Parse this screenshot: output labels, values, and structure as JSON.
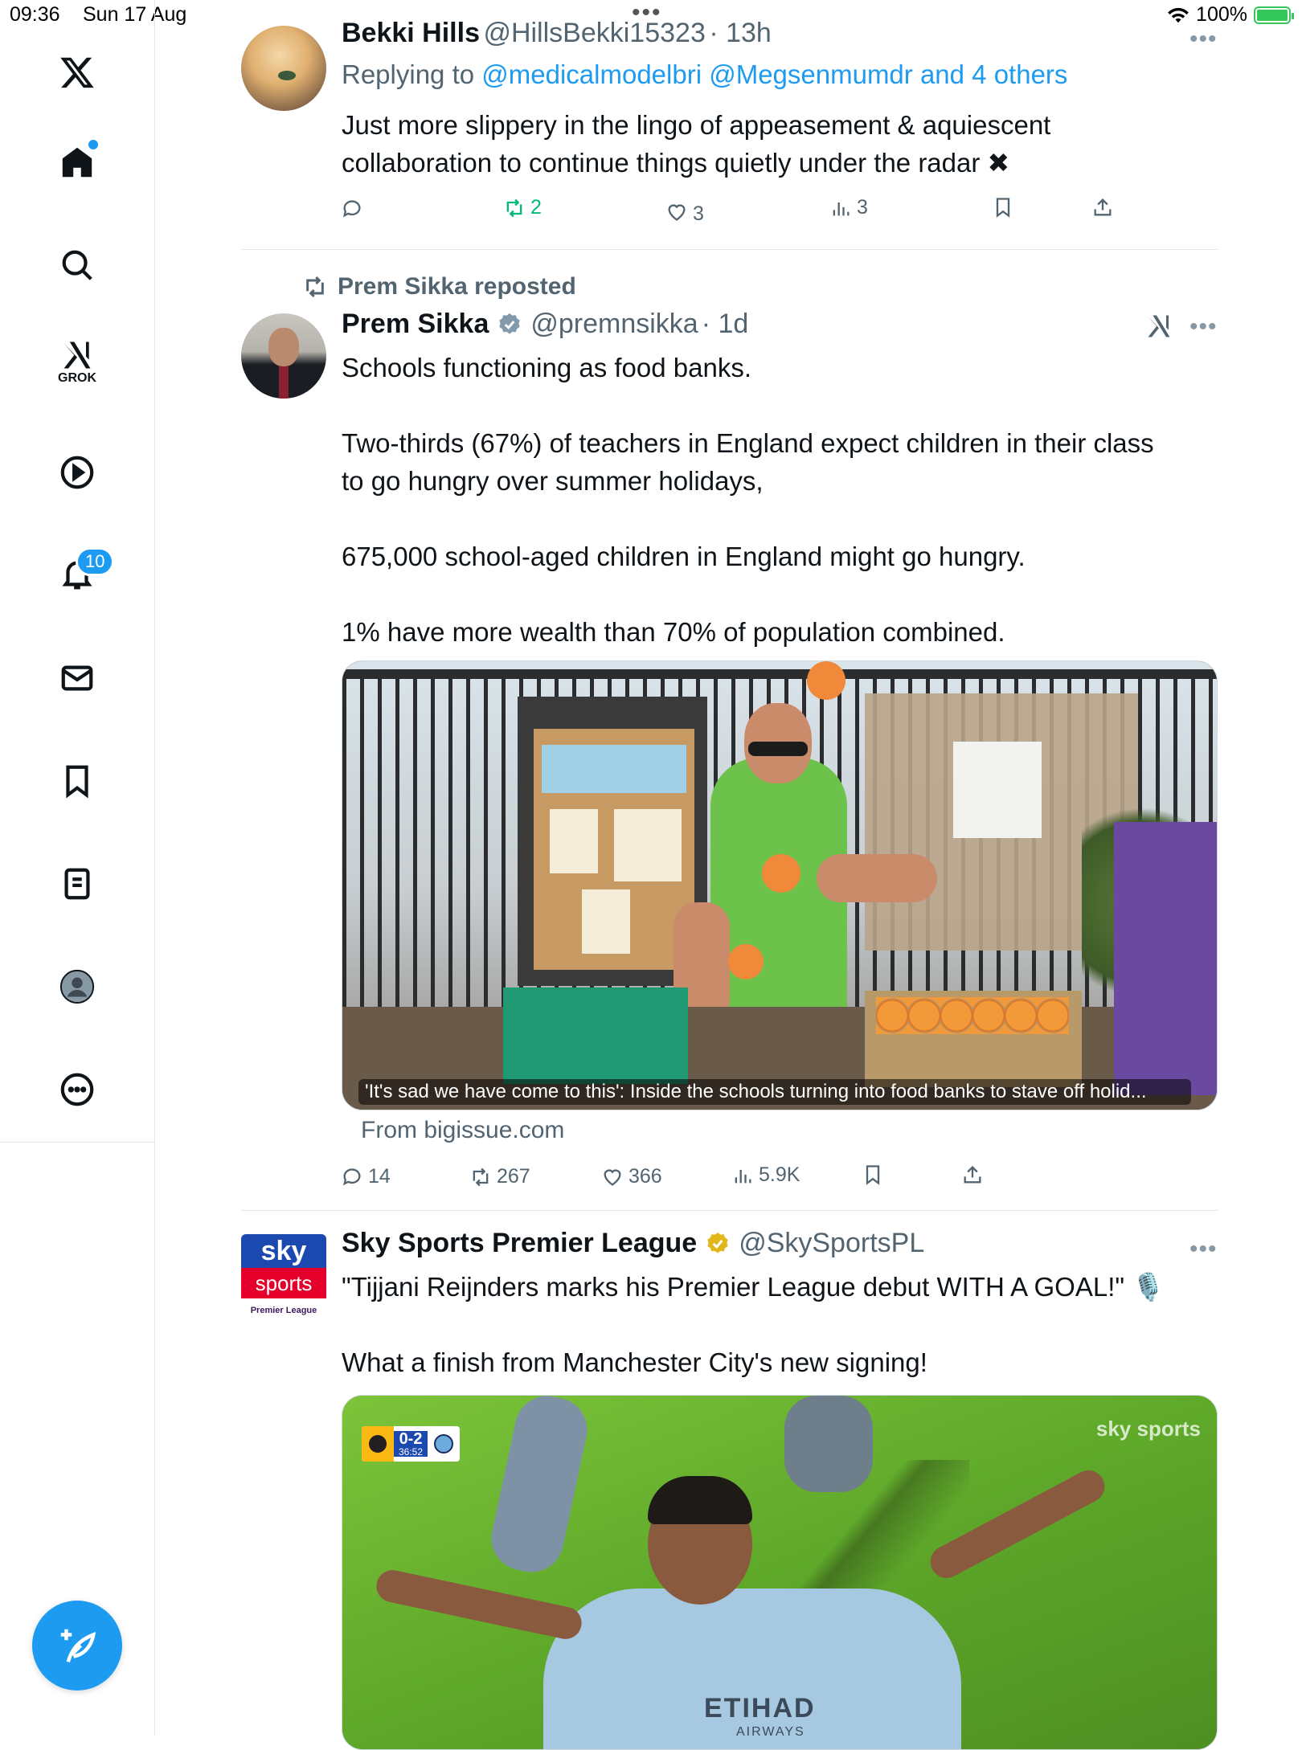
{
  "status_bar": {
    "time": "09:36",
    "date": "Sun 17 Aug",
    "battery": "100%"
  },
  "sidebar": {
    "grok_label": "GROK",
    "notifications_badge": "10"
  },
  "tweets": [
    {
      "name": "Bekki Hills",
      "handle": "@HillsBekki15323",
      "time": "· 13h",
      "replying_prefix": "Replying to ",
      "replying_to": "@medicalmodelbri @Megsenmumdr and 4 others",
      "text": "Just more slippery in the lingo of appeasement & aquiescent\ncollaboration to continue things quietly under the radar ✖",
      "stats": {
        "replies": "",
        "reposts": "2",
        "likes": "3",
        "views": "3"
      }
    },
    {
      "repost_label": "Prem Sikka reposted",
      "name": "Prem Sikka",
      "handle": "@premnsikka",
      "time": "· 1d",
      "text": "Schools functioning as food banks.\n\nTwo-thirds (67%) of teachers in England expect children in their class\nto go hungry over summer holidays,\n\n675,000 school-aged children in England might go hungry.\n\n1% have more wealth than 70% of population combined.",
      "card_caption": "'It's sad we have come to this': Inside the schools turning into food banks to stave off holid...",
      "card_source": "From bigissue.com",
      "stats": {
        "replies": "14",
        "reposts": "267",
        "likes": "366",
        "views": "5.9K"
      }
    },
    {
      "name": "Sky Sports Premier League",
      "handle": "@SkySportsPL",
      "text": "\"Tijjani Reijnders marks his Premier League debut WITH A GOAL!\" 🎙️\n\nWhat a finish from Manchester City's new signing!",
      "avatar_text": {
        "top": "sky",
        "bottom": "sports",
        "footer": "Premier League"
      },
      "media": {
        "score": "0-2",
        "clock": "36:52",
        "watermark": "sky sports",
        "shirt": "ETIHAD",
        "shirt_sub": "AIRWAYS"
      }
    }
  ],
  "colors": {
    "accent": "#1d9bf0",
    "repost_green": "#00ba7c",
    "verified_gold": "#e2b719",
    "text_secondary": "#536471"
  }
}
